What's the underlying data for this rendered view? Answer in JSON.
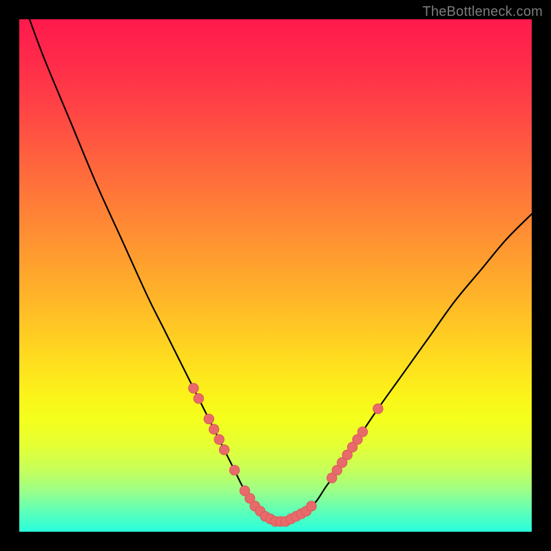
{
  "watermark": "TheBottleneck.com",
  "colors": {
    "frame": "#000000",
    "line": "#000000",
    "dot_fill": "#e86a6a",
    "dot_stroke": "#d85a5a",
    "watermark": "#7c7c7c"
  },
  "chart_data": {
    "type": "line",
    "title": "",
    "xlabel": "",
    "ylabel": "",
    "xlim": [
      0,
      100
    ],
    "ylim": [
      0,
      100
    ],
    "grid": false,
    "legend": false,
    "series": [
      {
        "name": "bottleneck-curve",
        "x": [
          2,
          5,
          10,
          15,
          20,
          25,
          28,
          31,
          34,
          36,
          38,
          40,
          42,
          44,
          46,
          48,
          50,
          52,
          54,
          56,
          58,
          60,
          63,
          66,
          70,
          75,
          80,
          85,
          90,
          95,
          100
        ],
        "y": [
          100,
          92,
          80,
          68,
          57,
          46,
          40,
          34,
          28,
          24,
          20,
          16,
          12,
          8,
          5,
          3,
          2,
          2,
          3,
          4,
          6,
          9,
          13,
          18,
          24,
          31,
          38,
          45,
          51,
          57,
          62
        ]
      }
    ],
    "highlight_points": [
      {
        "x": 34,
        "y": 28
      },
      {
        "x": 35,
        "y": 26
      },
      {
        "x": 37,
        "y": 22
      },
      {
        "x": 38,
        "y": 20
      },
      {
        "x": 39,
        "y": 18
      },
      {
        "x": 40,
        "y": 16
      },
      {
        "x": 42,
        "y": 12
      },
      {
        "x": 44,
        "y": 8
      },
      {
        "x": 45,
        "y": 6.5
      },
      {
        "x": 46,
        "y": 5
      },
      {
        "x": 47,
        "y": 4
      },
      {
        "x": 48,
        "y": 3
      },
      {
        "x": 49,
        "y": 2.5
      },
      {
        "x": 50,
        "y": 2
      },
      {
        "x": 51,
        "y": 2
      },
      {
        "x": 52,
        "y": 2
      },
      {
        "x": 53,
        "y": 2.5
      },
      {
        "x": 54,
        "y": 3
      },
      {
        "x": 55,
        "y": 3.5
      },
      {
        "x": 56,
        "y": 4
      },
      {
        "x": 57,
        "y": 5
      },
      {
        "x": 61,
        "y": 10.5
      },
      {
        "x": 62,
        "y": 12
      },
      {
        "x": 63,
        "y": 13.5
      },
      {
        "x": 64,
        "y": 15
      },
      {
        "x": 65,
        "y": 16.5
      },
      {
        "x": 66,
        "y": 18
      },
      {
        "x": 67,
        "y": 19.5
      },
      {
        "x": 70,
        "y": 24
      }
    ]
  }
}
